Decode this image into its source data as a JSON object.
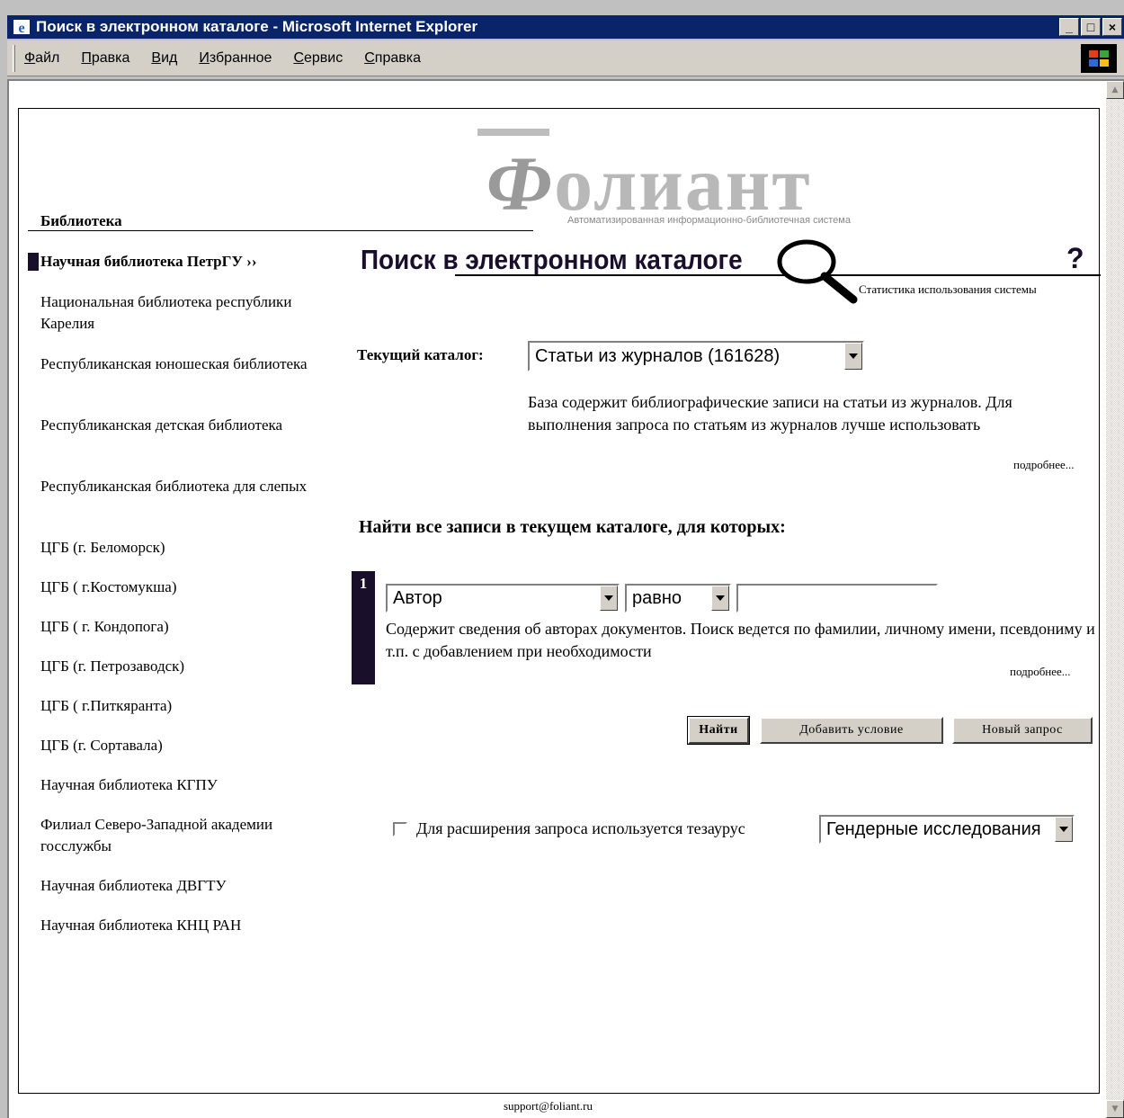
{
  "window": {
    "title": "Поиск в электронном каталоге - Microsoft Internet Explorer",
    "minimize": "_",
    "maximize": "□",
    "close": "×"
  },
  "menu": {
    "items": [
      {
        "accel": "Ф",
        "rest": "айл"
      },
      {
        "accel": "П",
        "rest": "равка"
      },
      {
        "accel": "В",
        "rest": "ид"
      },
      {
        "accel": "И",
        "rest": "збранное"
      },
      {
        "accel": "С",
        "rest": "ервис"
      },
      {
        "accel": "С",
        "rest": "правка"
      }
    ]
  },
  "logo": {
    "word_first": "Ф",
    "word_rest": "олиант",
    "subtitle": "Автоматизированная информационно-библиотечная система"
  },
  "nav": {
    "header": "Библиотека",
    "items": [
      {
        "label": "Научная библиотека ПетрГУ ››"
      },
      {
        "label": "Национальная библиотека республики Карелия"
      },
      {
        "label": "Республиканская юношеская библиотека"
      },
      {
        "label": "Республиканская детская библиотека"
      },
      {
        "label": "Республиканская библиотека для слепых"
      },
      {
        "label": "ЦГБ (г. Беломорск)"
      },
      {
        "label": "ЦГБ ( г.Костомукша)"
      },
      {
        "label": "ЦГБ ( г. Кондопога)"
      },
      {
        "label": "ЦГБ (г. Петрозаводск)"
      },
      {
        "label": "ЦГБ ( г.Питкяранта)"
      },
      {
        "label": "ЦГБ (г. Сортавала)"
      },
      {
        "label": "Научная библиотека КГПУ"
      },
      {
        "label": "Филиал Северо-Западной академии госслужбы"
      },
      {
        "label": "Научная библиотека ДВГТУ"
      },
      {
        "label": "Научная библиотека КНЦ РАН"
      }
    ]
  },
  "main": {
    "title": "Поиск в электронном каталоге",
    "help": "?",
    "stats_link": "Статистика использования системы",
    "catalog_label": "Текущий каталог:",
    "catalog_value": "Статьи из журналов (161628)",
    "catalog_desc": "База содержит библиографические записи на статьи из журналов. Для выполнения запроса по статьям из журналов лучше использовать",
    "more": "подробнее...",
    "find_title": "Найти все записи в текущем каталоге, для которых:",
    "condition": {
      "number": "1",
      "field": "Автор",
      "operator": "равно",
      "value": "",
      "desc": "Содержит сведения об авторах документов. Поиск ведется по фамилии, личному имени, псевдониму и т.п. с добавлением при необходимости",
      "more": "подробнее..."
    },
    "buttons": {
      "find": "Найти",
      "add": "Добавить условие",
      "new": "Новый запрос"
    },
    "thesaurus": {
      "label": "Для расширения запроса используется тезаурус",
      "value": "Гендерные исследования",
      "checked": false
    }
  },
  "footer": {
    "email": "support@foliant.ru"
  },
  "colors": {
    "titlebar": "#0a246a",
    "accent_dark": "#1a0f2a",
    "chrome": "#d4d0c8"
  }
}
